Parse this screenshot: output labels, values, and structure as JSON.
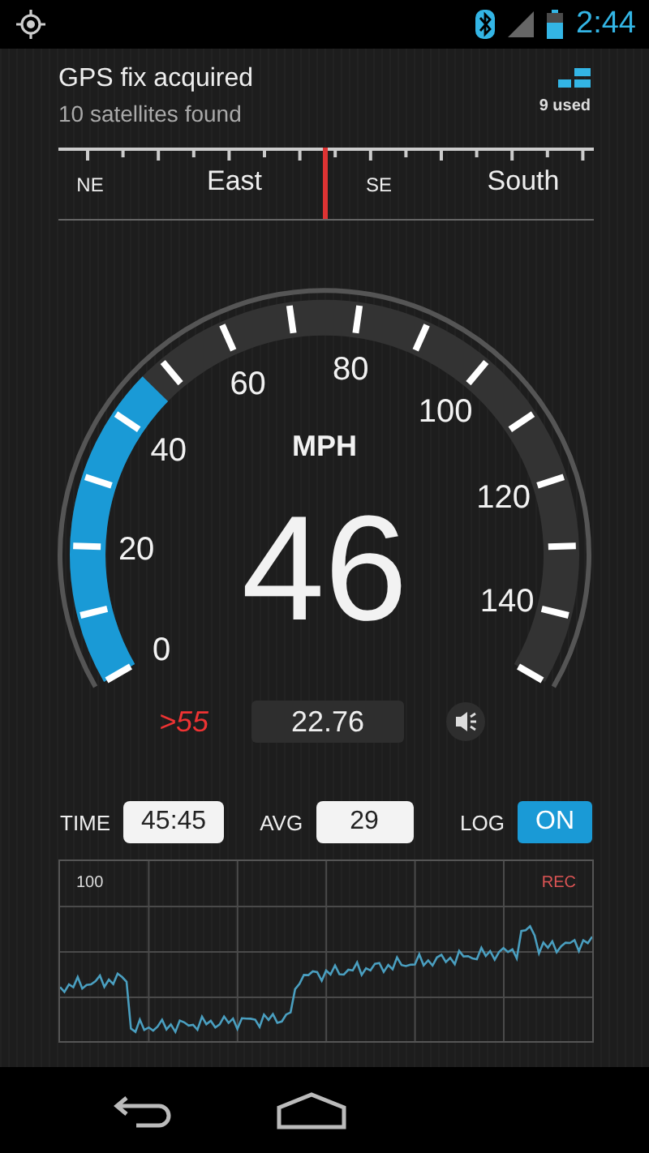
{
  "status_bar": {
    "time": "2:44"
  },
  "gps": {
    "title": "GPS fix acquired",
    "subtitle": "10 satellites found",
    "used": "9 used"
  },
  "compass": {
    "labels": [
      {
        "text": "NE",
        "kind": "minor"
      },
      {
        "text": "East",
        "kind": "major"
      },
      {
        "text": "SE",
        "kind": "minor"
      },
      {
        "text": "South",
        "kind": "major"
      }
    ]
  },
  "speedometer": {
    "scale": [
      "0",
      "20",
      "40",
      "60",
      "80",
      "100",
      "120",
      "140"
    ],
    "unit": "MPH",
    "speed": "46",
    "limit": ">55",
    "distance": "22.76"
  },
  "stats": {
    "time_label": "TIME",
    "time": "45:45",
    "avg_label": "AVG",
    "avg": "29",
    "log_label": "LOG",
    "log": {
      "label": "ON",
      "on": true
    }
  },
  "graph": {
    "max_label": "100",
    "rec": "REC"
  }
}
